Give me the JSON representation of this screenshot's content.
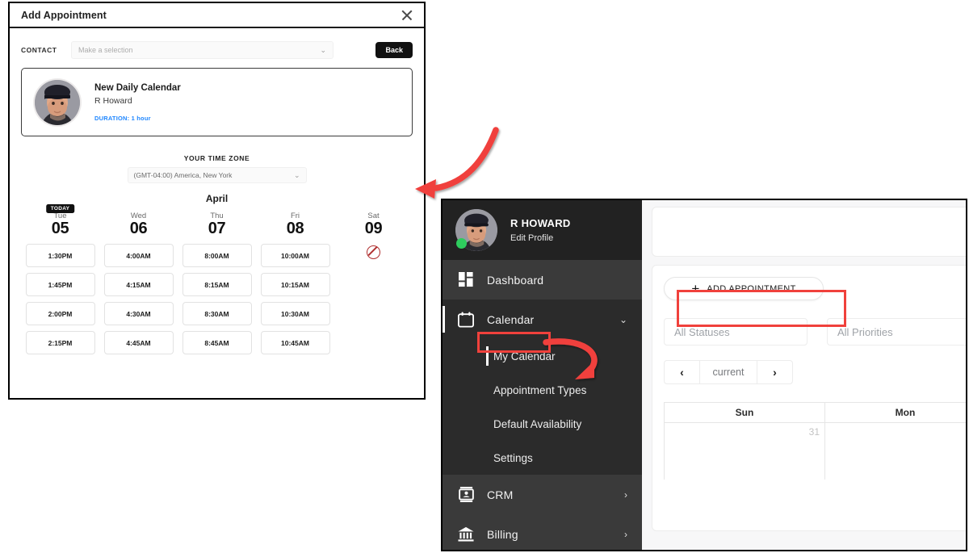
{
  "modal": {
    "title": "Add Appointment",
    "close_icon": "close-icon",
    "contact": {
      "label": "CONTACT",
      "placeholder": "Make a selection",
      "chevron": "⌄"
    },
    "back_label": "Back",
    "appointment_card": {
      "name": "New Daily Calendar",
      "host": "R Howard",
      "duration": "DURATION: 1 hour",
      "duration_color": "#1e86ff",
      "avatar": "user-avatar"
    },
    "timezone": {
      "label": "YOUR TIME ZONE",
      "value": "(GMT-04:00) America, New York",
      "chevron": "⌄"
    },
    "month": "April",
    "today_badge": "TODAY",
    "days": [
      {
        "dow": "Tue",
        "num": "05",
        "today": true,
        "slots": [
          "1:30PM",
          "1:45PM",
          "2:00PM",
          "2:15PM"
        ]
      },
      {
        "dow": "Wed",
        "num": "06",
        "today": false,
        "slots": [
          "4:00AM",
          "4:15AM",
          "4:30AM",
          "4:45AM"
        ]
      },
      {
        "dow": "Thu",
        "num": "07",
        "today": false,
        "slots": [
          "8:00AM",
          "8:15AM",
          "8:30AM",
          "8:45AM"
        ]
      },
      {
        "dow": "Fri",
        "num": "08",
        "today": false,
        "slots": [
          "10:00AM",
          "10:15AM",
          "10:30AM",
          "10:45AM"
        ]
      },
      {
        "dow": "Sat",
        "num": "09",
        "today": false,
        "slots": [],
        "unavailable_icon": "no-entry-icon"
      }
    ]
  },
  "app": {
    "sidebar": {
      "profile": {
        "name": "R HOWARD",
        "edit_link": "Edit Profile",
        "status": "online",
        "status_color": "#2ecc5e"
      },
      "items": [
        {
          "label": "Dashboard",
          "icon": "dashboard-grid-icon",
          "state": "light",
          "chevron": ""
        },
        {
          "label": "Calendar",
          "icon": "calendar-icon",
          "state": "dark",
          "chevron": "⌄",
          "expanded": true
        },
        {
          "label": "CRM",
          "icon": "contact-card-icon",
          "state": "light",
          "chevron": "›"
        },
        {
          "label": "Billing",
          "icon": "bank-icon",
          "state": "light",
          "chevron": "›"
        }
      ],
      "sub_items": [
        {
          "label": "My Calendar",
          "active": true
        },
        {
          "label": "Appointment Types",
          "active": false
        },
        {
          "label": "Default Availability",
          "active": false
        },
        {
          "label": "Settings",
          "active": false
        }
      ]
    },
    "main": {
      "cut_letter": "M",
      "add_appointment": {
        "label": "ADD APPOINTMENT",
        "plus_icon": "plus-icon"
      },
      "filters": [
        {
          "placeholder": "All Statuses"
        },
        {
          "placeholder": "All Priorities"
        }
      ],
      "pager": {
        "prev_icon": "chevron-left-icon",
        "current": "current",
        "next_icon": "chevron-right-icon"
      },
      "calendar": {
        "headers": [
          "Sun",
          "Mon"
        ],
        "cells": [
          "31",
          ""
        ]
      }
    }
  },
  "annotations": {
    "highlight_color": "#f0413c",
    "boxes": [
      "calendar-nav-highlight",
      "add-appointment-highlight"
    ],
    "arrows": [
      "arrow-to-timezone",
      "arrow-to-my-calendar"
    ]
  }
}
